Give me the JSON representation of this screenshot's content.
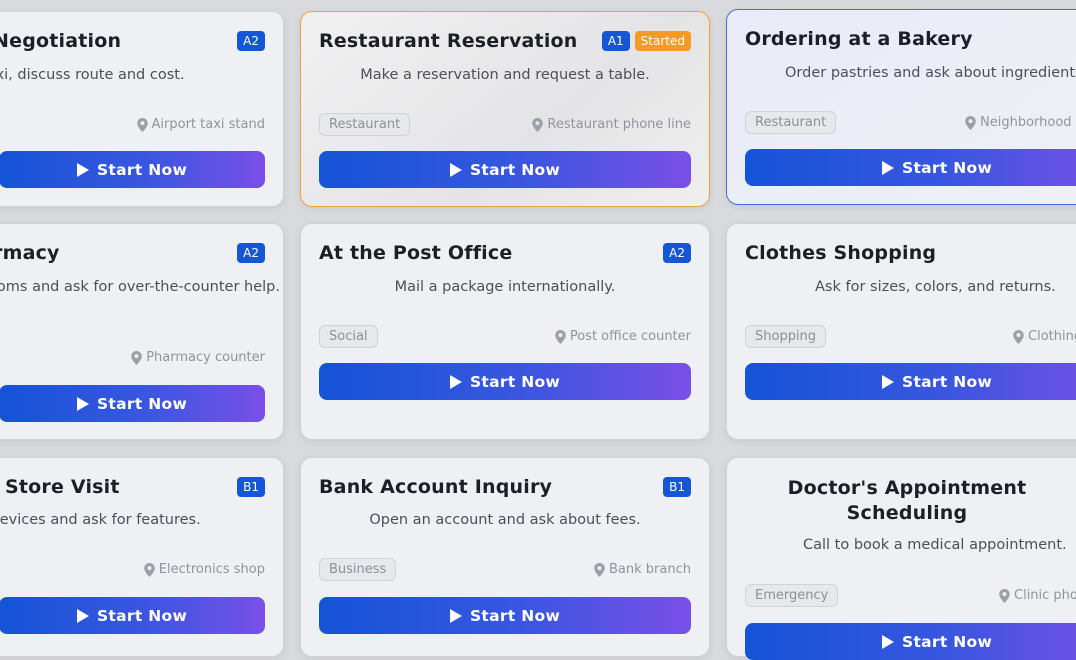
{
  "cards": [
    {
      "title": "Negotiation",
      "desc": "taxi, discuss route and cost.",
      "location": "Airport taxi stand",
      "level": "A2",
      "button": "Start Now"
    },
    {
      "title": "Restaurant Reservation",
      "desc": "Make a reservation and request a table.",
      "tag": "Restaurant",
      "location": "Restaurant phone line",
      "level": "A1",
      "status": "Started",
      "button": "Start Now"
    },
    {
      "title": "Ordering at a Bakery",
      "desc": "Order pastries and ask about ingredients.",
      "tag": "Restaurant",
      "location": "Neighborhood",
      "button": "Start Now"
    },
    {
      "title": "rmacy",
      "desc": "ptoms and ask for over-the-counter help.",
      "location": "Pharmacy counter",
      "level": "A2",
      "button": "Start Now"
    },
    {
      "title": "At the Post Office",
      "desc": "Mail a package internationally.",
      "tag": "Social",
      "location": "Post office counter",
      "level": "A2",
      "button": "Start Now"
    },
    {
      "title": "Clothes Shopping",
      "desc": "Ask for sizes, colors, and returns.",
      "tag": "Shopping",
      "location": "Clothing",
      "button": "Start Now"
    },
    {
      "title": "Store Visit",
      "desc": "e devices and ask for features.",
      "location": "Electronics shop",
      "level": "B1",
      "button": "Start Now"
    },
    {
      "title": "Bank Account Inquiry",
      "desc": "Open an account and ask about fees.",
      "tag": "Business",
      "location": "Bank branch",
      "level": "B1",
      "button": "Start Now"
    },
    {
      "title": "Doctor's Appointment Scheduling",
      "desc": "Call to book a medical appointment.",
      "tag": "Emergency",
      "location": "Clinic pho",
      "button": "Start Now"
    }
  ]
}
